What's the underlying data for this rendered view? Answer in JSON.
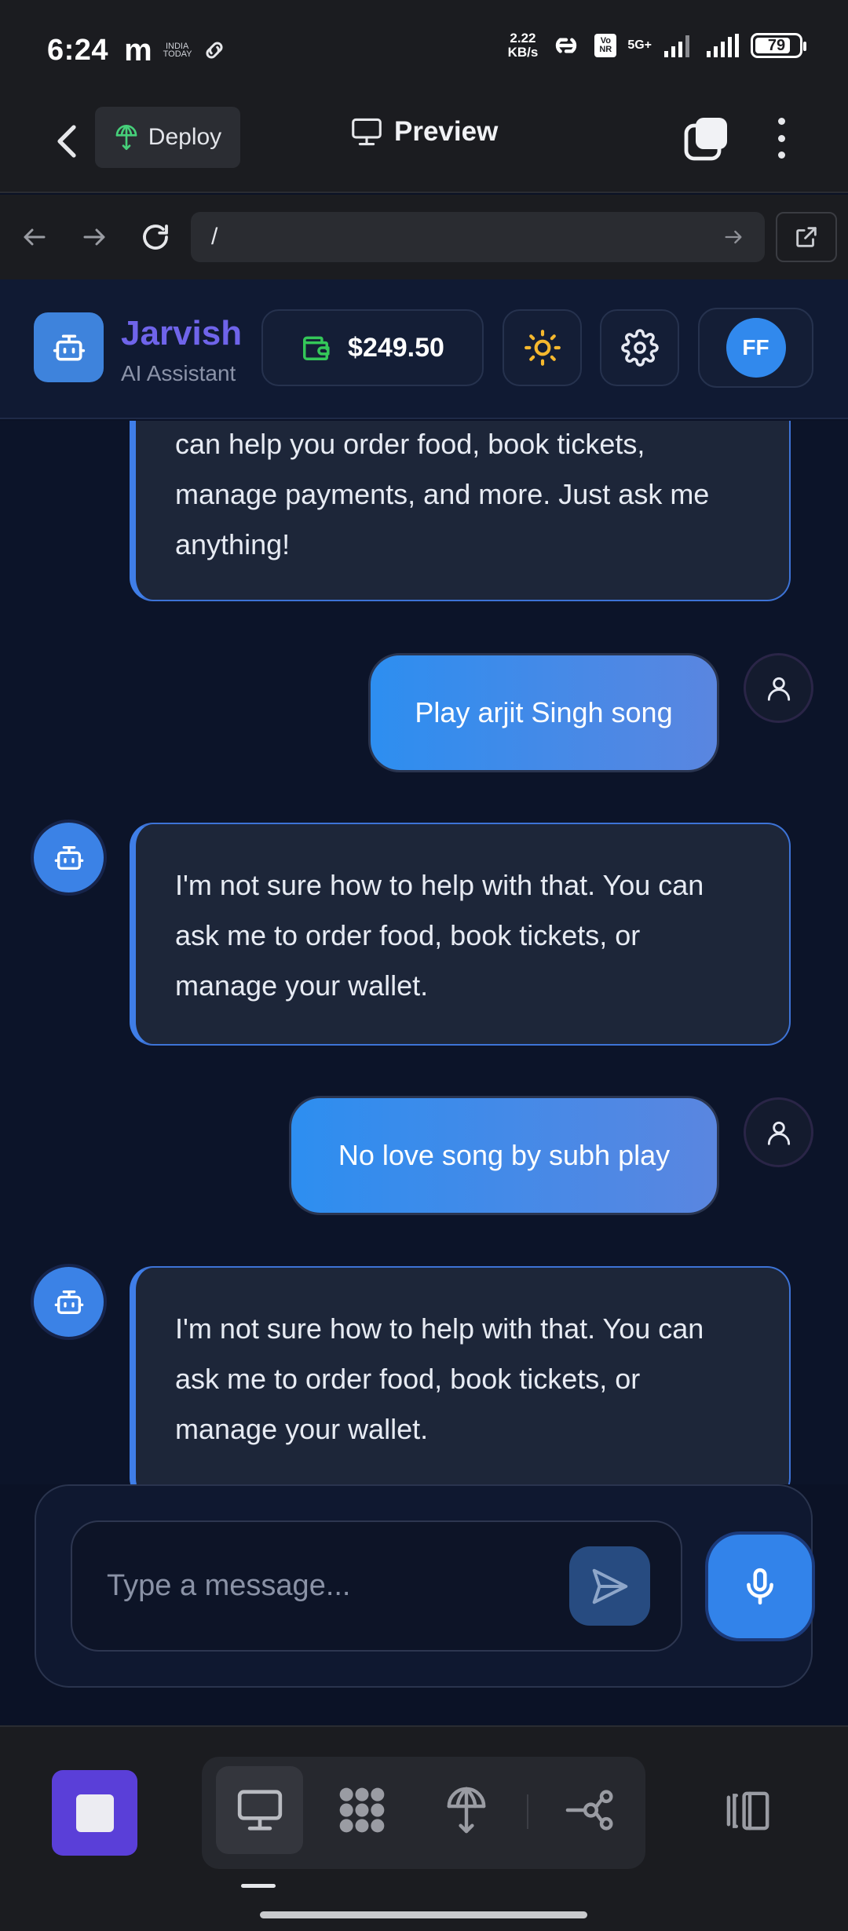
{
  "status_bar": {
    "time": "6:24",
    "m_app": "m",
    "news_app": "INDIA TODAY",
    "speed_value": "2.22",
    "speed_unit": "KB/s",
    "volte": "Vo NR",
    "network": "5G+",
    "battery": "79"
  },
  "toolbar": {
    "deploy_label": "Deploy",
    "preview_label": "Preview"
  },
  "browser": {
    "url": "/"
  },
  "header": {
    "app_name": "Jarvish",
    "app_subtitle": "AI Assistant",
    "wallet_balance": "$249.50",
    "avatar_initials": "FF"
  },
  "messages": [
    {
      "role": "bot",
      "lines": [
        "can help you order food, book tickets,",
        "manage payments, and more. Just ask me",
        "anything!"
      ]
    },
    {
      "role": "user",
      "text": "Play arjit Singh song"
    },
    {
      "role": "bot",
      "lines": [
        "I'm not sure how to help with that. You can",
        "ask me to order food, book tickets, or",
        "manage your wallet."
      ]
    },
    {
      "role": "user",
      "text": "No love song by subh play"
    },
    {
      "role": "bot",
      "lines": [
        "I'm not sure how to help with that. You can",
        "ask me to order food, book tickets, or",
        "manage your wallet."
      ]
    }
  ],
  "composer": {
    "placeholder": "Type a message..."
  },
  "colors": {
    "accent": "#3b82e6",
    "brand_title": "#6f64ea",
    "stop_button": "#5a3fd8",
    "wallet_icon": "#34c759",
    "sun_icon": "#f5b82e"
  }
}
